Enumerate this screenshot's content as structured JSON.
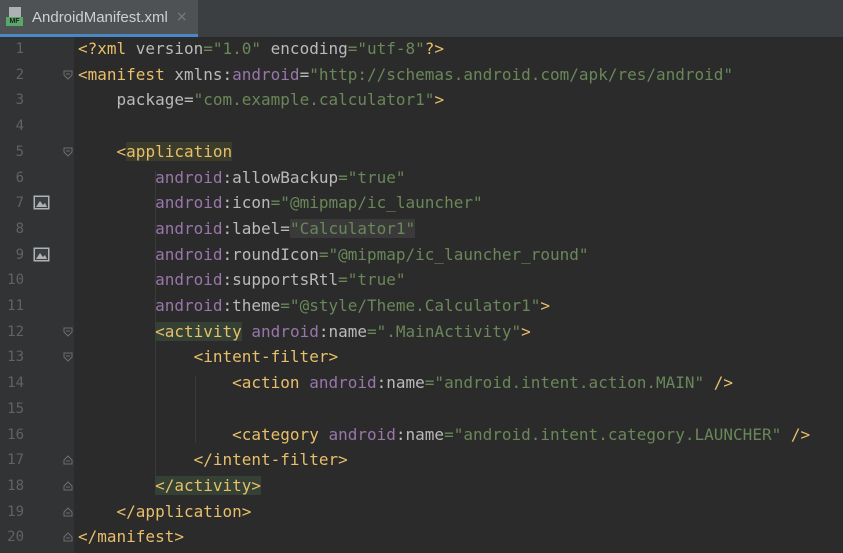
{
  "tab": {
    "title": "AndroidManifest.xml",
    "close": "×",
    "icon": "manifest-file-icon",
    "badge": "MF"
  },
  "lines": [
    {
      "n": "1",
      "tokens": [
        {
          "t": "<?",
          "c": "t-tag"
        },
        {
          "t": "xml ",
          "c": "t-tag"
        },
        {
          "t": "version",
          "c": "t-attr"
        },
        {
          "t": "=\"1.0\"",
          "c": "t-val"
        },
        {
          "t": " encoding",
          "c": "t-attr"
        },
        {
          "t": "=\"utf-8\"",
          "c": "t-val"
        },
        {
          "t": "?>",
          "c": "t-tag"
        }
      ]
    },
    {
      "n": "2",
      "fold": "open",
      "tokens": [
        {
          "t": "<manifest ",
          "c": "t-tag"
        },
        {
          "t": "xmlns:",
          "c": "t-attr"
        },
        {
          "t": "android",
          "c": "t-ns"
        },
        {
          "t": "=",
          "c": "t-attr"
        },
        {
          "t": "\"http://schemas.android.com/apk/res/android\"",
          "c": "t-val"
        }
      ]
    },
    {
      "n": "3",
      "tokens": [
        {
          "t": "    package",
          "c": "t-attr"
        },
        {
          "t": "=",
          "c": "t-attr"
        },
        {
          "t": "\"com.example.calculator1\"",
          "c": "t-val"
        },
        {
          "t": ">",
          "c": "t-tag"
        }
      ]
    },
    {
      "n": "4",
      "tokens": []
    },
    {
      "n": "5",
      "fold": "open",
      "tokens": [
        {
          "t": "    ",
          "c": ""
        },
        {
          "t": "<",
          "c": "t-tag"
        },
        {
          "t": "application",
          "c": "t-tag",
          "hl": "hl-app"
        }
      ]
    },
    {
      "n": "6",
      "tokens": [
        {
          "t": "        ",
          "c": ""
        },
        {
          "t": "android",
          "c": "t-ns"
        },
        {
          "t": ":allowBackup",
          "c": "t-attr"
        },
        {
          "t": "=\"true\"",
          "c": "t-val"
        }
      ]
    },
    {
      "n": "7",
      "gicon": true,
      "tokens": [
        {
          "t": "        ",
          "c": ""
        },
        {
          "t": "android",
          "c": "t-ns"
        },
        {
          "t": ":icon",
          "c": "t-attr"
        },
        {
          "t": "=\"@mipmap/ic_launcher\"",
          "c": "t-val"
        }
      ]
    },
    {
      "n": "8",
      "tokens": [
        {
          "t": "        ",
          "c": ""
        },
        {
          "t": "android",
          "c": "t-ns"
        },
        {
          "t": ":label",
          "c": "t-attr"
        },
        {
          "t": "=",
          "c": "t-attr"
        },
        {
          "t": "\"Calculator1\"",
          "c": "t-val",
          "hl": "hl-val"
        }
      ]
    },
    {
      "n": "9",
      "gicon": true,
      "tokens": [
        {
          "t": "        ",
          "c": ""
        },
        {
          "t": "android",
          "c": "t-ns"
        },
        {
          "t": ":roundIcon",
          "c": "t-attr"
        },
        {
          "t": "=\"@mipmap/ic_launcher_round\"",
          "c": "t-val"
        }
      ]
    },
    {
      "n": "10",
      "tokens": [
        {
          "t": "        ",
          "c": ""
        },
        {
          "t": "android",
          "c": "t-ns"
        },
        {
          "t": ":supportsRtl",
          "c": "t-attr"
        },
        {
          "t": "=\"true\"",
          "c": "t-val"
        }
      ]
    },
    {
      "n": "11",
      "tokens": [
        {
          "t": "        ",
          "c": ""
        },
        {
          "t": "android",
          "c": "t-ns"
        },
        {
          "t": ":theme",
          "c": "t-attr"
        },
        {
          "t": "=\"@style/Theme.Calculator1\"",
          "c": "t-val"
        },
        {
          "t": ">",
          "c": "t-tag"
        }
      ]
    },
    {
      "n": "12",
      "fold": "open",
      "tokens": [
        {
          "t": "        ",
          "c": ""
        },
        {
          "t": "<activity",
          "c": "t-tag",
          "hl": "hl-act"
        },
        {
          "t": " ",
          "c": ""
        },
        {
          "t": "android",
          "c": "t-ns"
        },
        {
          "t": ":name",
          "c": "t-attr"
        },
        {
          "t": "=\".MainActivity\"",
          "c": "t-val"
        },
        {
          "t": ">",
          "c": "t-tag"
        }
      ]
    },
    {
      "n": "13",
      "fold": "open",
      "tokens": [
        {
          "t": "            ",
          "c": ""
        },
        {
          "t": "<intent-filter>",
          "c": "t-tag"
        }
      ]
    },
    {
      "n": "14",
      "tokens": [
        {
          "t": "                ",
          "c": ""
        },
        {
          "t": "<action ",
          "c": "t-tag"
        },
        {
          "t": "android",
          "c": "t-ns"
        },
        {
          "t": ":name",
          "c": "t-attr"
        },
        {
          "t": "=\"android.intent.action.MAIN\"",
          "c": "t-val"
        },
        {
          "t": " />",
          "c": "t-tag"
        }
      ]
    },
    {
      "n": "15",
      "tokens": []
    },
    {
      "n": "16",
      "tokens": [
        {
          "t": "                ",
          "c": ""
        },
        {
          "t": "<category ",
          "c": "t-tag"
        },
        {
          "t": "android",
          "c": "t-ns"
        },
        {
          "t": ":name",
          "c": "t-attr"
        },
        {
          "t": "=\"android.intent.category.LAUNCHER\"",
          "c": "t-val"
        },
        {
          "t": " />",
          "c": "t-tag"
        }
      ]
    },
    {
      "n": "17",
      "fold": "close",
      "tokens": [
        {
          "t": "            ",
          "c": ""
        },
        {
          "t": "</intent-filter>",
          "c": "t-tag"
        }
      ]
    },
    {
      "n": "18",
      "fold": "close",
      "tokens": [
        {
          "t": "        ",
          "c": ""
        },
        {
          "t": "</activity>",
          "c": "t-tag",
          "hl": "hl-act"
        }
      ]
    },
    {
      "n": "19",
      "fold": "close",
      "tokens": [
        {
          "t": "    ",
          "c": ""
        },
        {
          "t": "</application>",
          "c": "t-tag"
        }
      ]
    },
    {
      "n": "20",
      "fold": "close",
      "tokens": [
        {
          "t": "</manifest>",
          "c": "t-tag"
        }
      ]
    }
  ]
}
